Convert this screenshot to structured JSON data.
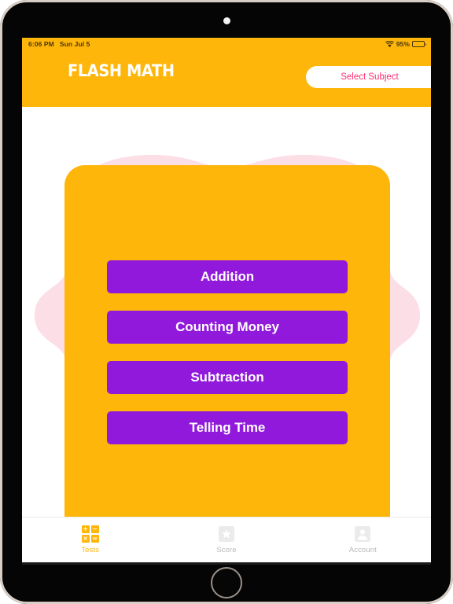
{
  "device": {
    "name": "tablet-frame",
    "camera_icon": "camera-dot",
    "home_button_icon": "home-button-circle"
  },
  "status_bar": {
    "time": "6:06 PM",
    "date": "Sun Jul 5",
    "wifi_icon": "wifi-icon",
    "battery_percent": "95%",
    "battery_icon": "battery-icon",
    "background_color": "#FFB60A"
  },
  "header": {
    "logo_text": "FLASH MATH",
    "select_subject_label": "Select Subject",
    "background_color": "#FFB60A",
    "accent_pink": "#FF2D6F"
  },
  "main": {
    "card_color": "#FFB60A",
    "blob_color": "#FCDEE7",
    "button_color": "#9119DB",
    "subjects": [
      {
        "label": "Addition"
      },
      {
        "label": "Counting Money"
      },
      {
        "label": "Subtraction"
      },
      {
        "label": "Telling Time"
      }
    ]
  },
  "tabbar": {
    "tabs": [
      {
        "label": "Tests",
        "icon": "math-grid-icon",
        "active": true
      },
      {
        "label": "Score",
        "icon": "star-icon",
        "active": false
      },
      {
        "label": "Account",
        "icon": "person-icon",
        "active": false
      }
    ],
    "active_color": "#FFB60A",
    "inactive_color": "#b8b8b8",
    "grid_symbols": [
      "+",
      "−",
      "×",
      "="
    ]
  }
}
